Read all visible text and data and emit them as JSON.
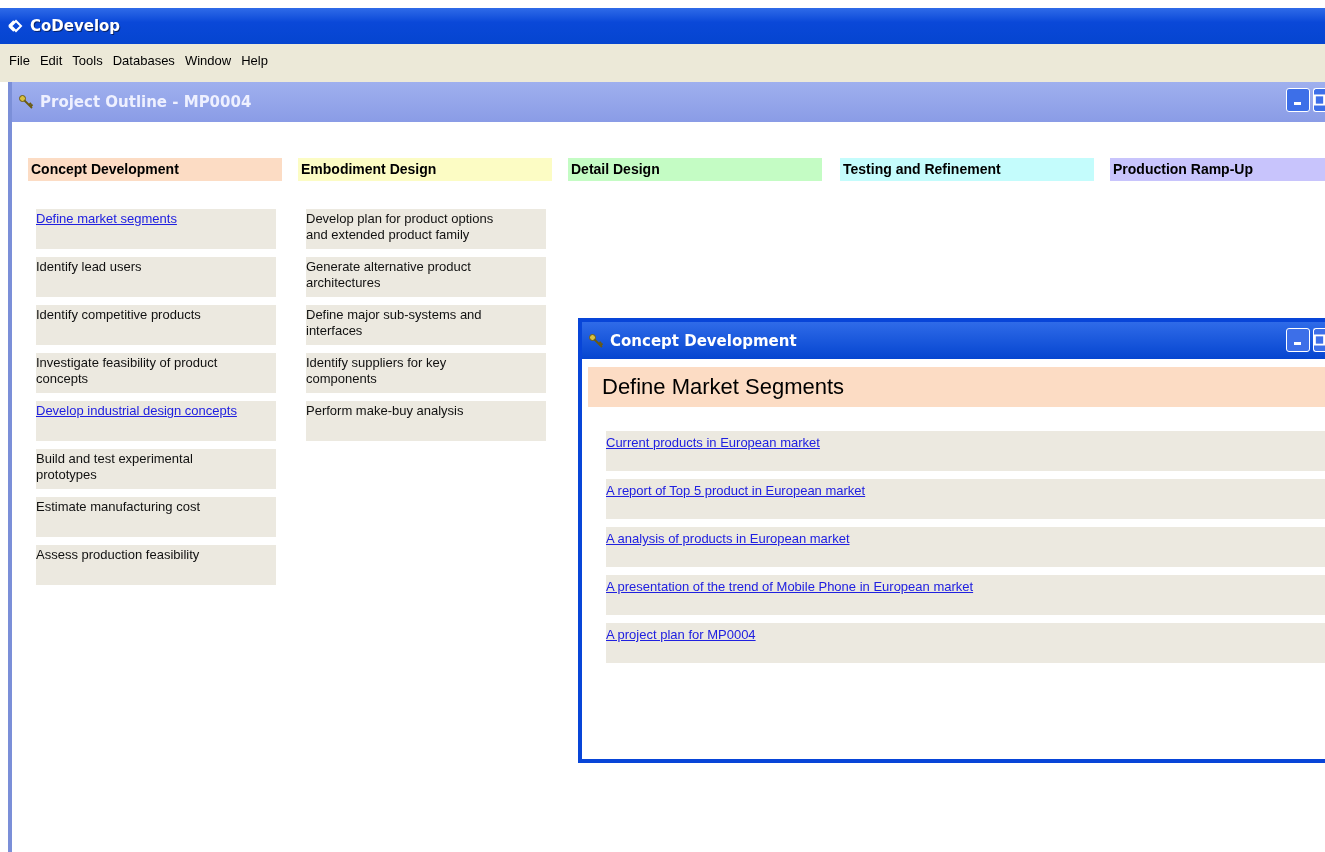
{
  "app": {
    "title": "CoDevelop"
  },
  "menu": [
    {
      "label": "File"
    },
    {
      "label": "Edit"
    },
    {
      "label": "Tools"
    },
    {
      "label": "Databases"
    },
    {
      "label": "Window"
    },
    {
      "label": "Help"
    }
  ],
  "outline_window": {
    "title": "Project Outline - MP0004",
    "phases": [
      {
        "title": "Concept Development",
        "color": "#fcdcc4",
        "tasks": [
          {
            "label": "Define market segments",
            "kind": "link"
          },
          {
            "label": "Identify lead users",
            "kind": "text"
          },
          {
            "label": "Identify competitive products",
            "kind": "text"
          },
          {
            "label": "Investigate feasibility of product concepts",
            "kind": "text"
          },
          {
            "label": "Develop industrial design concepts",
            "kind": "link"
          },
          {
            "label": "Build and test experimental prototypes",
            "kind": "text"
          },
          {
            "label": "Estimate manufacturing cost",
            "kind": "text"
          },
          {
            "label": "Assess production feasibility",
            "kind": "text"
          }
        ]
      },
      {
        "title": "Embodiment Design",
        "color": "#fcfcc4",
        "tasks": [
          {
            "label": "Develop plan for product options and extended product family",
            "kind": "text"
          },
          {
            "label": "Generate alternative product architectures",
            "kind": "text"
          },
          {
            "label": "Define major sub-systems and interfaces",
            "kind": "text"
          },
          {
            "label": "Identify suppliers for key components",
            "kind": "text"
          },
          {
            "label": "Perform make-buy analysis",
            "kind": "text"
          }
        ]
      },
      {
        "title": "Detail Design",
        "color": "#c4fcc4"
      },
      {
        "title": "Testing and Refinement",
        "color": "#c4fcfc"
      },
      {
        "title": "Production Ramp-Up",
        "color": "#c8c4fc"
      }
    ]
  },
  "detail_window": {
    "title": "Concept Development",
    "heading": "Define Market Segments",
    "color": "#fcdcc4",
    "links": [
      {
        "label": "Current products in European market"
      },
      {
        "label": "A report of Top 5 product in European market"
      },
      {
        "label": "A analysis of products in European market"
      },
      {
        "label": "A presentation of the trend of Mobile Phone  in European market"
      },
      {
        "label": "A project plan for MP0004"
      }
    ]
  }
}
